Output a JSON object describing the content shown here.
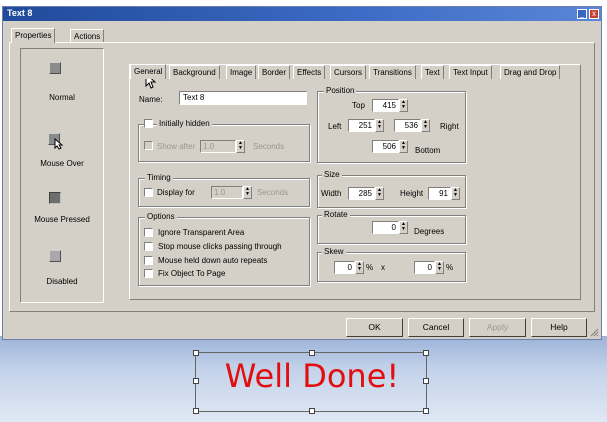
{
  "window": {
    "title": "Text 8",
    "minimize_glyph": "_",
    "close_glyph": "x"
  },
  "left_tabs": [
    "Properties",
    "Actions"
  ],
  "states": [
    {
      "label": "Normal",
      "icon": "normal-state-icon"
    },
    {
      "label": "Mouse Over",
      "icon": "mouse-over-state-icon"
    },
    {
      "label": "Mouse Pressed",
      "icon": "mouse-pressed-state-icon"
    },
    {
      "label": "Disabled",
      "icon": "disabled-state-icon"
    }
  ],
  "tabs": [
    "General",
    "Background",
    "Image",
    "Border",
    "Effects",
    "Cursors",
    "Transitions",
    "Text",
    "Text Input",
    "Drag and Drop"
  ],
  "general": {
    "name_label": "Name:",
    "name_value": "Text 8",
    "initially_hidden_label": "Initially hidden",
    "show_after_label": "Show after",
    "show_after_value": "1.0",
    "seconds_label": "Seconds",
    "timing_label": "Timing",
    "display_for_label": "Display for",
    "display_for_value": "1.0",
    "display_seconds_label": "Seconds",
    "options_label": "Options",
    "options": [
      "Ignore Transparent Area",
      "Stop mouse clicks passing through",
      "Mouse held down auto repeats",
      "Fix Object To Page"
    ]
  },
  "position": {
    "label": "Position",
    "top_label": "Top",
    "top_value": "415",
    "left_label": "Left",
    "left_value": "251",
    "right_label": "Right",
    "right_value": "536",
    "bottom_label": "Bottom",
    "bottom_value": "506"
  },
  "size": {
    "label": "Size",
    "width_label": "Width",
    "width_value": "285",
    "height_label": "Height",
    "height_value": "91"
  },
  "rotate": {
    "label": "Rotate",
    "value": "0",
    "unit": "Degrees"
  },
  "skew": {
    "label": "Skew",
    "x_value": "0",
    "y_value": "0",
    "percent": "%",
    "times": "x"
  },
  "buttons": {
    "ok": "OK",
    "cancel": "Cancel",
    "apply": "Apply",
    "help": "Help"
  },
  "canvas": {
    "text": "Well Done!",
    "text_color": "#e01010"
  },
  "colors": {
    "title_bar": "#2a56ac",
    "dialog_bg": "#d4d0c8"
  }
}
